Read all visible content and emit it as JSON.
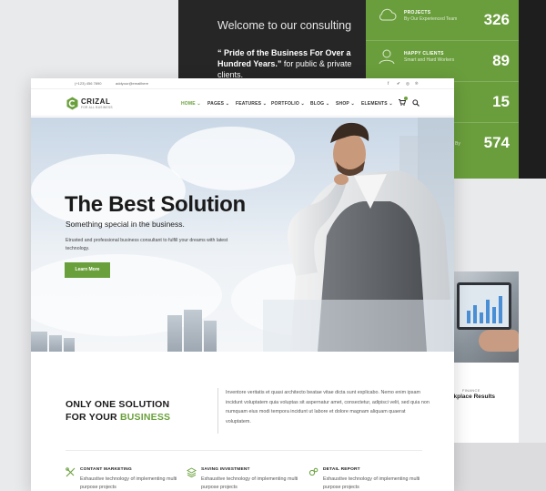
{
  "colors": {
    "brand_green": "#6aa03c",
    "dark_panel": "#262626",
    "stats_green": "#6a9e3c"
  },
  "bg_panel": {
    "welcome": "Welcome to our consulting",
    "quote_bold": "“ Pride of the Business For Over a Hundred Years.”",
    "quote_rest": " for public & private clients."
  },
  "stats": [
    {
      "label": "PROJECTS",
      "sub": "By Our Experienced Team",
      "value": "326",
      "icon": "cloud-icon"
    },
    {
      "label": "HAPPY CLIENTS",
      "sub": "Smart and Hard Workers",
      "value": "89",
      "icon": "user-icon"
    },
    {
      "label": "",
      "sub": "",
      "value": "15",
      "icon": ""
    },
    {
      "label": "",
      "sub": "By",
      "value": "574",
      "icon": ""
    }
  ],
  "blog_card": {
    "category": "FINANCE",
    "title": "rkplace Results"
  },
  "topbar": {
    "phone": "(+123) 456 7890",
    "email": "addyour@emailhere",
    "icons": [
      "facebook-icon",
      "twitter-icon",
      "instagram-icon",
      "pinterest-icon"
    ]
  },
  "logo": {
    "name": "CRIZAL",
    "tagline": "FOR ALL BUSINESS"
  },
  "nav": {
    "items": [
      "HOME",
      "PAGES",
      "FEATURES",
      "PORTFOLIO",
      "BLOG",
      "SHOP",
      "ELEMENTS"
    ],
    "active": "HOME"
  },
  "hero": {
    "title": "The Best Solution",
    "subtitle": "Something special in the business.",
    "text": "Etrusted and professional business consultant to fulfill your dreams with latest technology.",
    "button": "Learn More"
  },
  "about": {
    "title_line1": "ONLY ONE SOLUTION",
    "title_line2_prefix": "FOR YOUR ",
    "title_line2_highlight": "BUSINESS",
    "text": "Inventore veritatis et quasi architecto beatae vitae dicta sunt explicabo. Nemo enim ipsam incidunt voluptatem quia voluptas sit aspernatur amet, consectetur, adipisci velit, sed quia non numquam eius modi tempora incidunt ut labore et dolore magnam aliquam quaerat voluptatem."
  },
  "features": [
    {
      "title": "CONTANT MARKETING",
      "text": "Exhaustive technology of implementing multi purpose projects",
      "icon": "tools-icon"
    },
    {
      "title": "SAVING INVESTMENT",
      "text": "Exhaustive technology of implementing multi purpose projects",
      "icon": "layers-icon"
    },
    {
      "title": "DETAIL REPORT",
      "text": "Exhaustive technology of implementing multi purpose projects",
      "icon": "gears-icon"
    }
  ]
}
